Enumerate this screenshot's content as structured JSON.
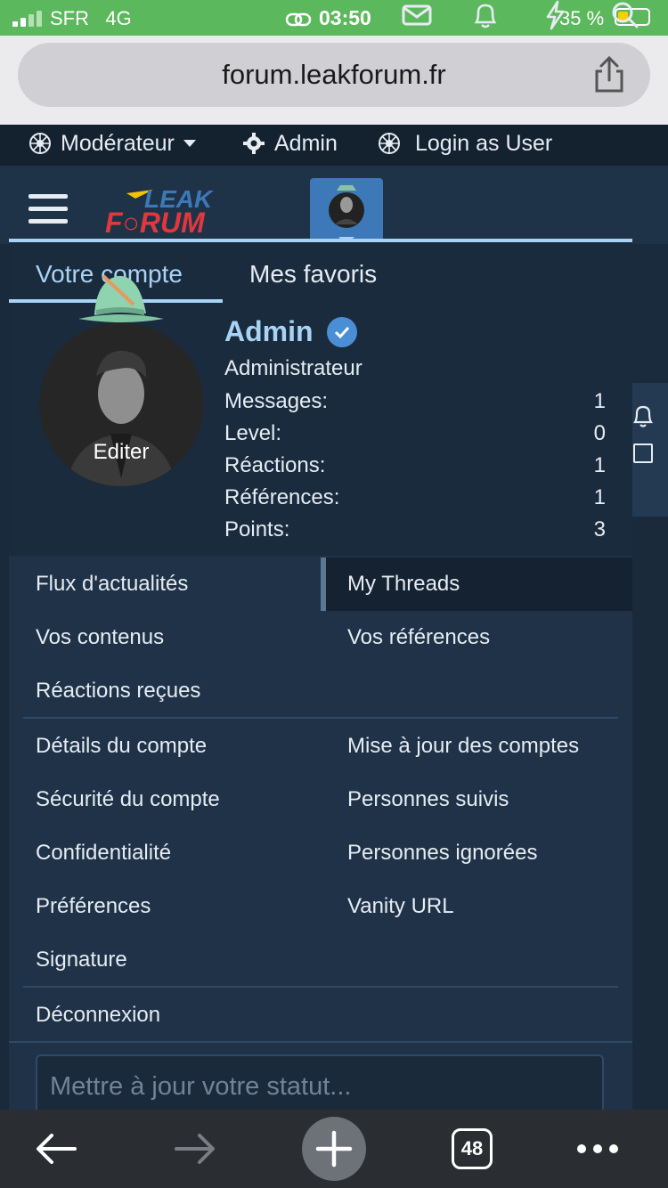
{
  "status_bar": {
    "carrier": "SFR",
    "network": "4G",
    "time": "03:50",
    "battery": "35 %"
  },
  "browser": {
    "url": "forum.leakforum.fr"
  },
  "admin_bar": {
    "moderator": "Modérateur",
    "admin": "Admin",
    "login_as": "Login as User"
  },
  "menu": {
    "tabs": [
      "Votre compte",
      "Mes favoris"
    ],
    "profile": {
      "name": "Admin",
      "role": "Administrateur",
      "edit": "Editer",
      "stats": [
        {
          "label": "Messages:",
          "value": "1"
        },
        {
          "label": "Level:",
          "value": "0"
        },
        {
          "label": "Réactions:",
          "value": "1"
        },
        {
          "label": "Références:",
          "value": "1"
        },
        {
          "label": "Points:",
          "value": "3"
        }
      ]
    },
    "links_left_1": [
      "Flux d'actualités",
      "Vos contenus",
      "Réactions reçues"
    ],
    "links_right_1": [
      "My Threads",
      "Vos références"
    ],
    "links_left_2": [
      "Détails du compte",
      "Sécurité du compte",
      "Confidentialité",
      "Préférences",
      "Signature"
    ],
    "links_right_2": [
      "Mise à jour des comptes",
      "Personnes suivis",
      "Personnes ignorées",
      "Vanity URL"
    ],
    "logout": "Déconnexion",
    "status_placeholder": "Mettre à jour votre statut..."
  },
  "toolbar": {
    "tab_count": "48"
  },
  "colors": {
    "accent": "#a9d3f5",
    "panel": "#1f3248",
    "header": "#1e3347",
    "statusbar": "#5cb85c"
  }
}
